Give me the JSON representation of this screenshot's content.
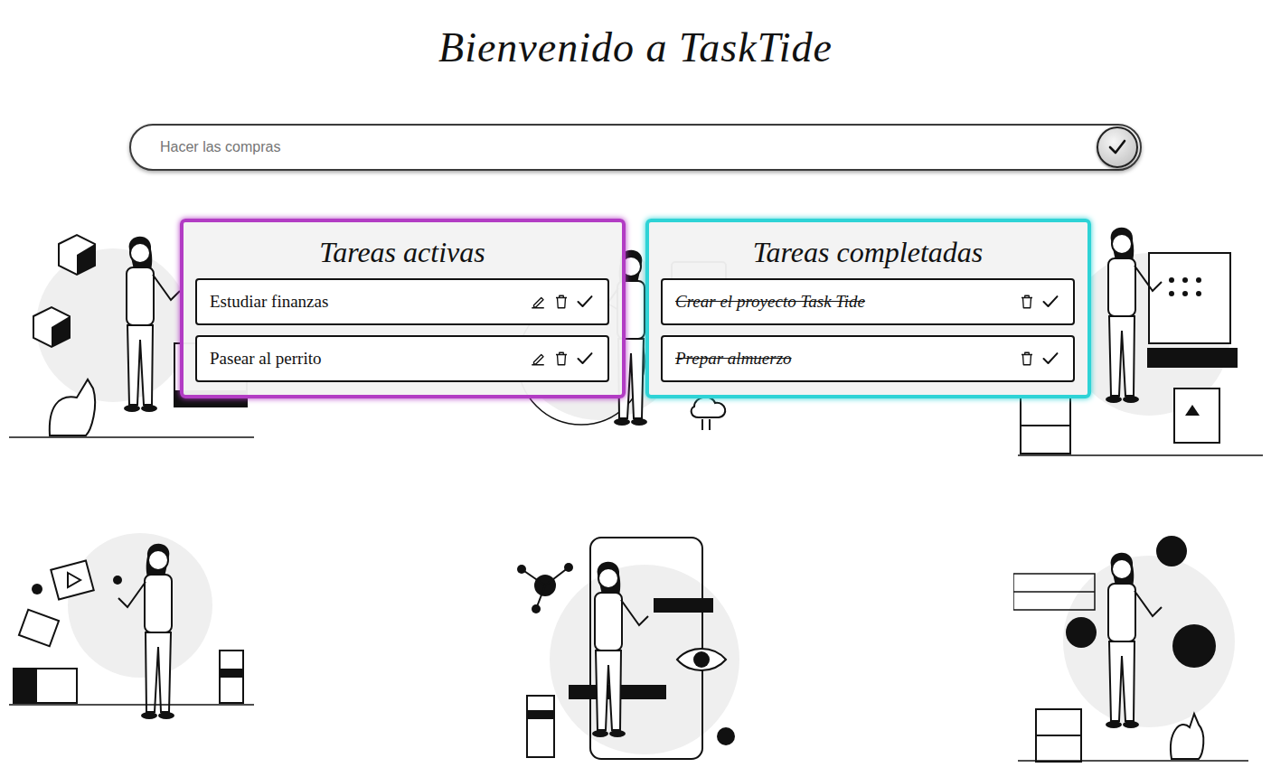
{
  "title": "Bienvenido a TaskTide",
  "input": {
    "placeholder": "Hacer las compras"
  },
  "panels": [
    {
      "title": "Tareas activas",
      "color": "#b23cc4",
      "tasks": [
        {
          "text": "Estudiar finanzas",
          "completed": false
        },
        {
          "text": "Pasear al perrito",
          "completed": false
        }
      ]
    },
    {
      "title": "Tareas completadas",
      "color": "#2ed3d6",
      "tasks": [
        {
          "text": "Crear el proyecto Task Tide",
          "completed": true
        },
        {
          "text": "Prepar almuerzo",
          "completed": true
        }
      ]
    }
  ]
}
